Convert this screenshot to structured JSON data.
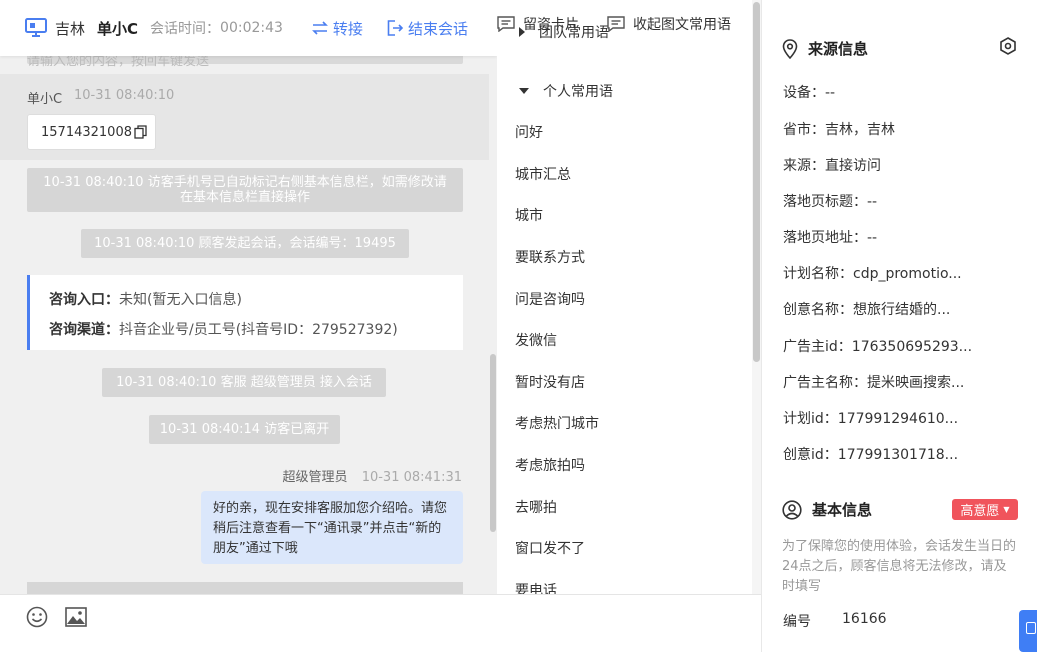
{
  "header": {
    "city": "吉林",
    "customer_name": "单小C",
    "session_time_label": "会话时间：",
    "session_time": "00:02:43",
    "transfer_label": "转接",
    "end_label": "结束会话"
  },
  "chat": {
    "visitor_msg": {
      "name": "单小C",
      "time": "10-31 08:40:10",
      "phone": "15714321008"
    },
    "system_1": "10-31 08:40:10 访客手机号已自动标记右侧基本信息栏，如需修改请在基本信息栏直接操作",
    "system_2": "10-31 08:40:10 顾客发起会话，会话编号：19495",
    "entry_label": "咨询入口：",
    "entry_value": "未知(暂无入口信息)",
    "channel_label": "咨询渠道：",
    "channel_value": "抖音企业号/员工号(抖音号ID：279527392)",
    "system_3": "10-31 08:40:10 客服 超级管理员 接入会话",
    "system_4": "10-31 08:40:14 访客已离开",
    "agent_name": "超级管理员",
    "agent_time": "10-31 08:41:31",
    "agent_message": "好的亲，现在安排客服加您介绍哈。请您稍后注意查看一下“通讯录”并点击“新的朋友”通过下哦"
  },
  "input": {
    "card_label": "留资卡片",
    "collapse_label": "收起图文常用语",
    "hint": "请输入您的内容，按回车键发送"
  },
  "phrases": {
    "team_group": "团队常用语",
    "personal_group": "个人常用语",
    "items": [
      "问好",
      "城市汇总",
      "城市",
      "要联系方式",
      "问是咨询吗",
      "发微信",
      "暂时没有店",
      "考虑热门城市",
      "考虑旅拍吗",
      "去哪拍",
      "窗口发不了",
      "要电话"
    ]
  },
  "source": {
    "title": "来源信息",
    "fields": [
      {
        "label": "设备：",
        "value": "--"
      },
      {
        "label": "省市：",
        "value": "吉林，吉林"
      },
      {
        "label": "来源：",
        "value": "直接访问"
      },
      {
        "label": "落地页标题：",
        "value": "--"
      },
      {
        "label": "落地页地址：",
        "value": "--"
      },
      {
        "label": "计划名称：",
        "value": "cdp_promotio..."
      },
      {
        "label": "创意名称：",
        "value": "想旅行结婚的..."
      },
      {
        "label": "广告主id：",
        "value": "176350695293..."
      },
      {
        "label": "广告主名称：",
        "value": "提米映画搜索..."
      },
      {
        "label": "计划id：",
        "value": "177991294610..."
      },
      {
        "label": "创意id：",
        "value": "177991301718..."
      }
    ]
  },
  "basic": {
    "title": "基本信息",
    "intent_badge": "高意愿",
    "notice": "为了保障您的使用体验，会话发生当日的24点之后，顾客信息将无法修改，请及时填写",
    "number_label": "编号",
    "number_value": "16166"
  },
  "colors": {
    "accent": "#4a7ef0",
    "badge": "#f0545c",
    "agent_bubble": "#dbe7fb"
  }
}
